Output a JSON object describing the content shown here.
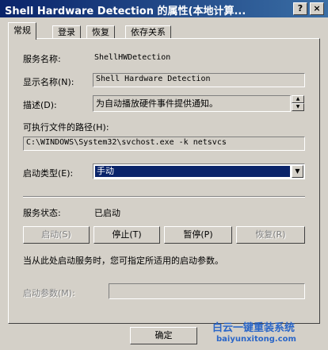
{
  "window": {
    "title": "Shell Hardware Detection 的属性(本地计算..."
  },
  "titlebar": {
    "help_glyph": "?",
    "close_glyph": "×"
  },
  "tabs": [
    {
      "label": "常规"
    },
    {
      "label": "登录"
    },
    {
      "label": "恢复"
    },
    {
      "label": "依存关系"
    }
  ],
  "general": {
    "service_name_label": "服务名称:",
    "service_name_value": "ShellHWDetection",
    "display_name_label": "显示名称(N):",
    "display_name_value": "Shell Hardware Detection",
    "description_label": "描述(D):",
    "description_value": "为自动播放硬件事件提供通知。",
    "exe_path_label": "可执行文件的路径(H):",
    "exe_path_value": "C:\\WINDOWS\\System32\\svchost.exe -k netsvcs",
    "startup_type_label": "启动类型(E):",
    "startup_type_value": "手动",
    "status_label": "服务状态:",
    "status_value": "已启动",
    "buttons": {
      "start": "启动(S)",
      "stop": "停止(T)",
      "pause": "暂停(P)",
      "resume": "恢复(R)"
    },
    "hint": "当从此处启动服务时，您可指定所适用的启动参数。",
    "start_params_label": "启动参数(M):",
    "start_params_value": ""
  },
  "footer": {
    "ok_label": "确定"
  },
  "watermark": {
    "cn": "白云一键重装系统",
    "en": "baiyunxitong.com"
  }
}
